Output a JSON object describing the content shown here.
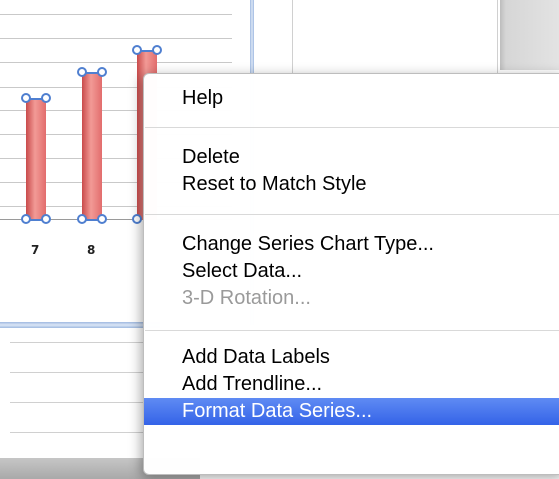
{
  "chart": {
    "axis_labels": [
      "7",
      "8"
    ]
  },
  "context_menu": {
    "groups": [
      [
        {
          "label": "Help",
          "state": "normal"
        }
      ],
      [
        {
          "label": "Delete",
          "state": "normal"
        },
        {
          "label": "Reset to Match Style",
          "state": "normal"
        }
      ],
      [
        {
          "label": "Change Series Chart Type...",
          "state": "normal"
        },
        {
          "label": "Select Data...",
          "state": "normal"
        },
        {
          "label": "3-D Rotation...",
          "state": "disabled"
        }
      ],
      [
        {
          "label": "Add Data Labels",
          "state": "normal"
        },
        {
          "label": "Add Trendline...",
          "state": "normal"
        },
        {
          "label": "Format Data Series...",
          "state": "selected"
        }
      ]
    ]
  },
  "colors": {
    "bar": "#e26d6d",
    "selection_handle": "#4f7fd0",
    "menu_highlight": "#3463e8"
  }
}
